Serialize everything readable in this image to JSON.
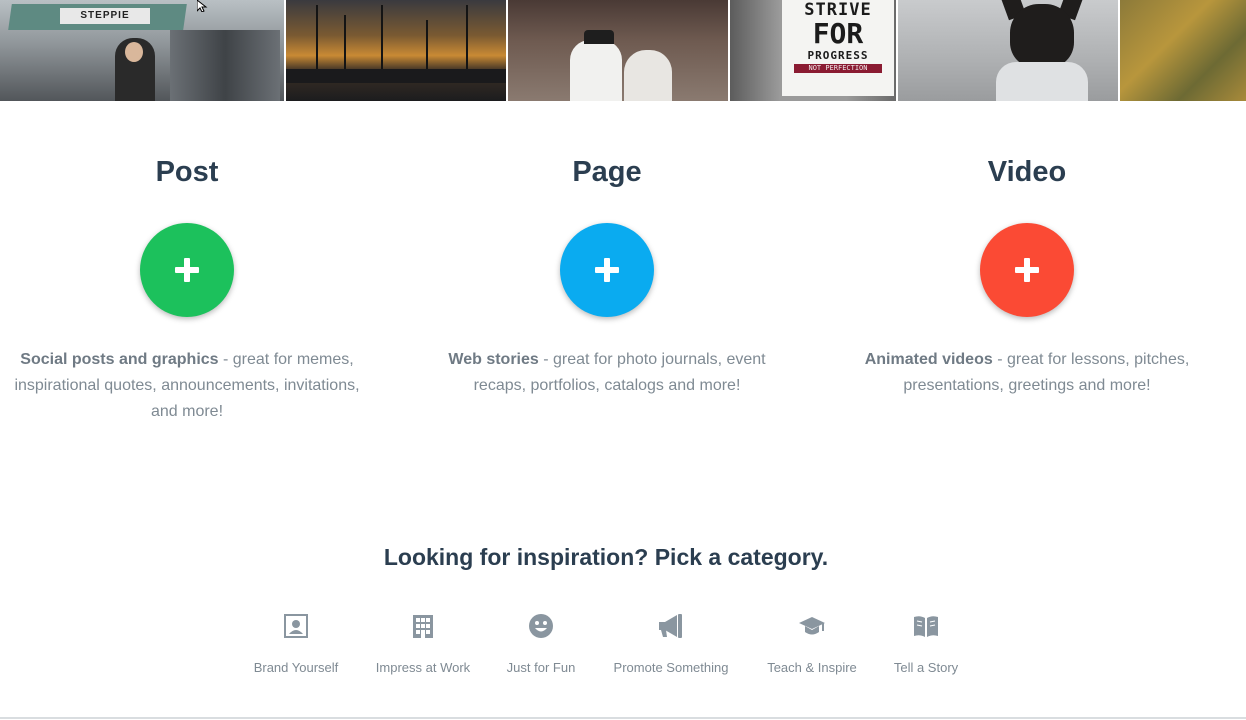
{
  "banner": {
    "market_sign": "STEPPIE",
    "poster": {
      "line1": "STRIVE",
      "line2": "FOR",
      "line3": "PROGRESS",
      "line4": "NOT PERFECTION"
    }
  },
  "create": [
    {
      "title": "Post",
      "button_color": "#1cc15c",
      "desc_bold": "Social posts and graphics",
      "desc_rest": " - great for memes, inspirational quotes, announcements, invitations, and more!"
    },
    {
      "title": "Page",
      "button_color": "#0aabf0",
      "desc_bold": "Web stories",
      "desc_rest": " - great for photo journals, event recaps, portfolios, catalogs and more!"
    },
    {
      "title": "Video",
      "button_color": "#fb4a34",
      "desc_bold": "Animated videos",
      "desc_rest": " - great for lessons, pitches, presentations, greetings and more!"
    }
  ],
  "inspiration": {
    "title": "Looking for inspiration? Pick a category.",
    "categories": [
      {
        "label": "Brand Yourself",
        "icon": "portrait-icon"
      },
      {
        "label": "Impress at Work",
        "icon": "building-icon"
      },
      {
        "label": "Just for Fun",
        "icon": "smiley-icon"
      },
      {
        "label": "Promote Something",
        "icon": "megaphone-icon"
      },
      {
        "label": "Teach & Inspire",
        "icon": "graduation-cap-icon"
      },
      {
        "label": "Tell a Story",
        "icon": "open-book-icon"
      }
    ]
  },
  "colors": {
    "heading": "#2b3e50",
    "body_text": "#7f8a93",
    "icon_gray": "#8a96a0"
  }
}
